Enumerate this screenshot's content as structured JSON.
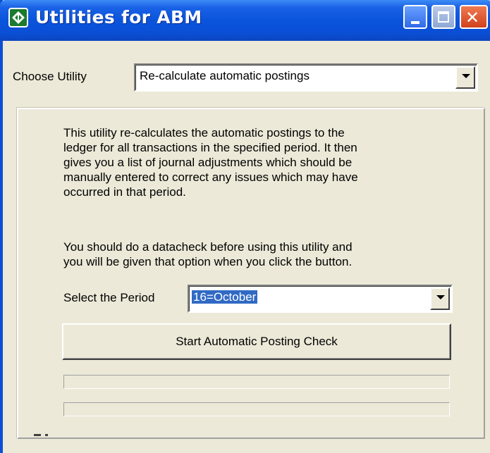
{
  "window": {
    "title": "Utilities for ABM",
    "icon": "abm-app-icon",
    "controls": [
      "minimize-icon",
      "maximize-icon",
      "close-icon"
    ],
    "close_glyph": "✕"
  },
  "utility": {
    "label": "Choose Utility",
    "selected": "Re-calculate automatic postings"
  },
  "description": {
    "paragraph1": [
      "This utility re-calculates the automatic postings to the",
      "ledger for all transactions in the specified period. It then",
      "gives you a list of journal adjustments which should be",
      "manually entered to correct any issues which may have",
      "occurred in that period."
    ],
    "paragraph2": [
      "You should do a datacheck before using this utility and",
      "you will be given that option when you click the button."
    ]
  },
  "period": {
    "label": "Select the Period",
    "selected": "16=October"
  },
  "action": {
    "button_label": "Start Automatic Posting Check"
  },
  "colors": {
    "titlebar": "#0a4fd6",
    "window_bg": "#ece9d8",
    "selection": "#316ac5"
  }
}
